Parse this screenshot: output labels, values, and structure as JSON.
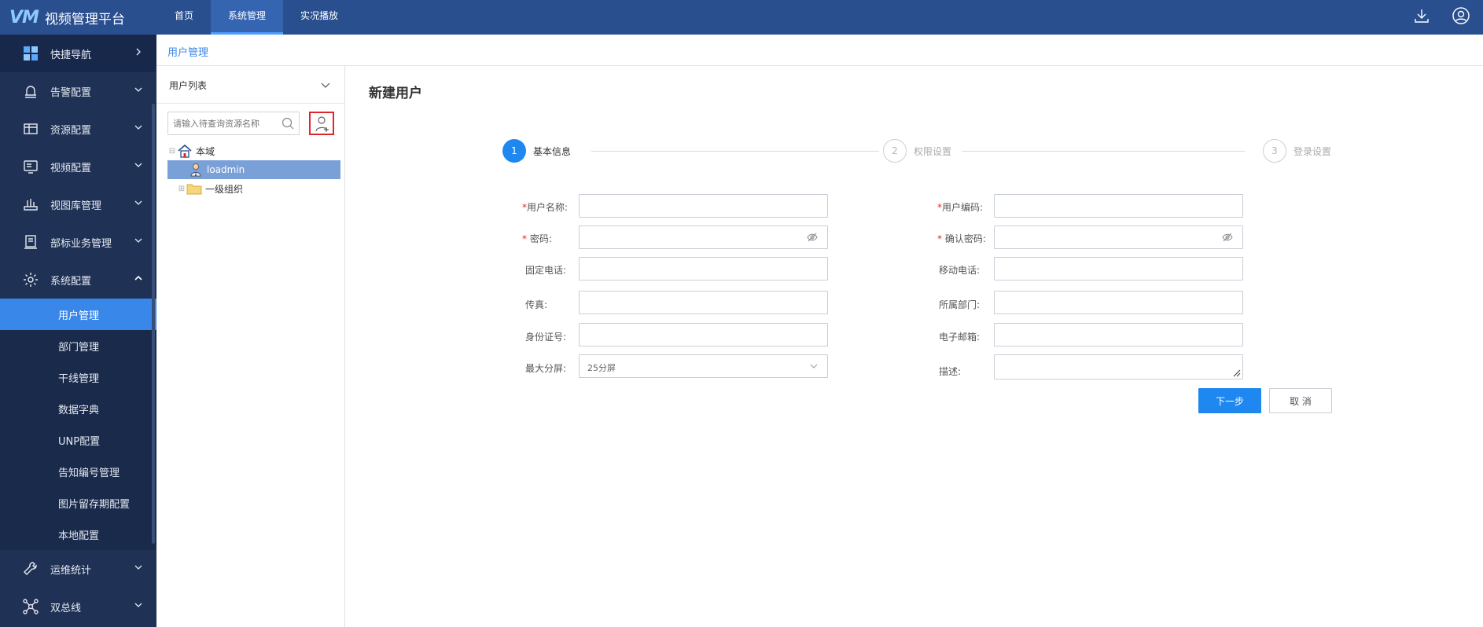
{
  "app": {
    "logo_mark": "VM",
    "title": "视频管理平台"
  },
  "topnav": {
    "items": [
      {
        "label": "首页"
      },
      {
        "label": "系统管理",
        "active": true
      },
      {
        "label": "实况播放"
      }
    ],
    "icons": [
      "download-icon",
      "user-icon"
    ]
  },
  "sidebar": {
    "items": [
      {
        "label": "快捷导航",
        "icon": "grid-icon",
        "chevron": "right"
      },
      {
        "label": "告警配置",
        "icon": "alarm-icon",
        "chevron": "down"
      },
      {
        "label": "资源配置",
        "icon": "resource-icon",
        "chevron": "down"
      },
      {
        "label": "视频配置",
        "icon": "video-icon",
        "chevron": "down"
      },
      {
        "label": "视图库管理",
        "icon": "library-icon",
        "chevron": "down"
      },
      {
        "label": "部标业务管理",
        "icon": "business-icon",
        "chevron": "down"
      },
      {
        "label": "系统配置",
        "icon": "gear-icon",
        "chevron": "up"
      }
    ],
    "subitems": [
      {
        "label": "用户管理",
        "active": true
      },
      {
        "label": "部门管理"
      },
      {
        "label": "干线管理"
      },
      {
        "label": "数据字典"
      },
      {
        "label": "UNP配置"
      },
      {
        "label": "告知编号管理"
      },
      {
        "label": "图片留存期配置"
      },
      {
        "label": "本地配置"
      }
    ],
    "bottom_items": [
      {
        "label": "运维统计",
        "icon": "wrench-icon",
        "chevron": "down"
      },
      {
        "label": "双总线",
        "icon": "bus-icon",
        "chevron": "down"
      }
    ]
  },
  "breadcrumb": "用户管理",
  "user_list": {
    "title": "用户列表",
    "search_placeholder": "请输入待查询资源名称",
    "tree": [
      {
        "label": "本域",
        "icon": "home-icon",
        "level": 0
      },
      {
        "label": "loadmin",
        "icon": "user-person-icon",
        "level": 1,
        "selected": true
      },
      {
        "label": "一级组织",
        "icon": "folder-icon",
        "level": 1
      }
    ]
  },
  "main": {
    "title": "新建用户",
    "steps": [
      {
        "num": "1",
        "label": "基本信息",
        "active": true
      },
      {
        "num": "2",
        "label": "权限设置",
        "active": false
      },
      {
        "num": "3",
        "label": "登录设置",
        "active": false
      }
    ],
    "form": {
      "username_label": "用户名称:",
      "usercode_label": "用户编码:",
      "password_label": "密码:",
      "confirm_password_label": "确认密码:",
      "phone_label": "固定电话:",
      "mobile_label": "移动电话:",
      "fax_label": "传真:",
      "department_label": "所属部门:",
      "idcard_label": "身份证号:",
      "email_label": "电子邮箱:",
      "max_split_label": "最大分屏:",
      "max_split_value": "25分屏",
      "description_label": "描述:",
      "required_mark": "*"
    },
    "next_button": "下一步",
    "cancel_button": "取 消"
  },
  "colors": {
    "topbar": "#2a4f8f",
    "sidebar": "#1f3154",
    "accent": "#1e88f0",
    "required": "#e0262c"
  }
}
